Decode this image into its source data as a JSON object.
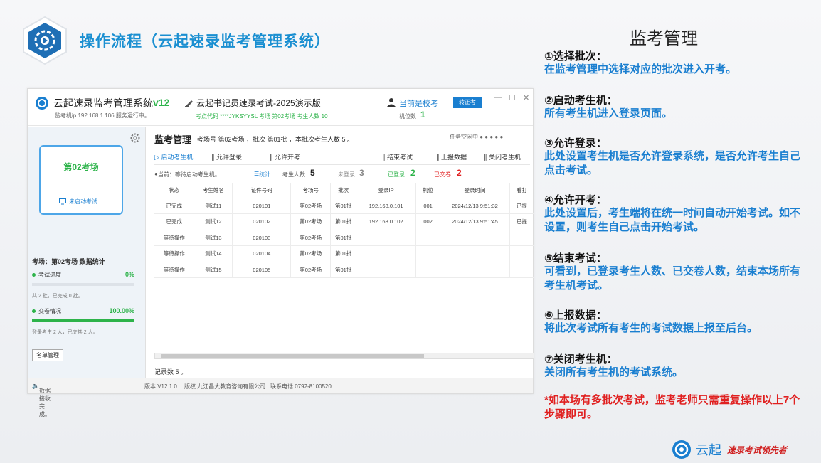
{
  "slide": {
    "title": "操作流程（云起速录监考管理系统）",
    "brand_name": "云起",
    "brand_slogan": "速录考试领先者"
  },
  "app": {
    "name": "云起速录监考管理系统",
    "version": "v12",
    "ip_line": "监考机ip 192.168.1.106 服务运行中。",
    "exam_name": "云起书记员速录考试-2025演示版",
    "exam_code_line": "考点代码 ****JYKSYYSL 考场 第02考场 考生人数 10",
    "invigilator_label": "当前是校考",
    "seat_label": "机位数",
    "seat_count": "1",
    "swap_button": "转正考",
    "window_controls": {
      "min": "—",
      "max": "☐",
      "close": "✕"
    }
  },
  "left_panel": {
    "room_name": "第02考场",
    "room_state": "未启动考试",
    "stats_title": "考场：第02考场 数据统计",
    "progress_label": "考试进度",
    "progress_value": "0%",
    "progress_fraction": 0,
    "progress_desc": "共 2 批，已完成 0 批。",
    "submit_label": "交卷情况",
    "submit_value": "100.00%",
    "submit_fraction": 1,
    "submit_desc": "登录考生 2 人，已交卷 2 人。",
    "roster_button": "名单管理"
  },
  "main": {
    "title": "监考管理",
    "info": "考场号 第02考场 ，批次 第01批 ，本批次考生人数 5 。",
    "task_label": "任务空闲中 ● ● ● ● ●",
    "toolbar": {
      "start": "启动考生机",
      "allow_login": "允许登录",
      "allow_start": "允许开考",
      "end_exam": "结束考试",
      "upload": "上报数据",
      "shutdown": "关闭考生机"
    },
    "status": {
      "current": "当前：等待启动考生机。",
      "stats_label": "统计",
      "total_label": "考生人数",
      "total": "5",
      "not_logged_label": "未登录",
      "not_logged": "3",
      "logged_label": "已登录",
      "logged": "2",
      "submitted_label": "已交卷",
      "submitted": "2"
    },
    "table": {
      "headers": [
        "状态",
        "考生姓名",
        "证件号码",
        "考场号",
        "批次",
        "登录IP",
        "机位",
        "登录时间",
        "看打"
      ],
      "rows": [
        [
          "已完成",
          "测试11",
          "020101",
          "第02考场",
          "第01批",
          "192.168.0.101",
          "001",
          "2024/12/13 9:51:32",
          "已提"
        ],
        [
          "已完成",
          "测试12",
          "020102",
          "第02考场",
          "第01批",
          "192.168.0.102",
          "002",
          "2024/12/13 9:51:45",
          "已提"
        ],
        [
          "等待操作",
          "测试13",
          "020103",
          "第02考场",
          "第01批",
          "",
          "",
          "",
          ""
        ],
        [
          "等待操作",
          "测试14",
          "020104",
          "第02考场",
          "第01批",
          "",
          "",
          "",
          ""
        ],
        [
          "等待操作",
          "测试15",
          "020105",
          "第02考场",
          "第01批",
          "",
          "",
          "",
          ""
        ]
      ]
    },
    "record_count": "记录数 5 。"
  },
  "status_bar": {
    "message": "数据接收完成。",
    "version": "版本 V12.1.0",
    "copyright": "版权 九江昌大教育咨询有限公司",
    "phone": "联系电话 0792-8100520"
  },
  "guide": {
    "title": "监考管理",
    "steps": [
      {
        "heading": "①选择批次：",
        "desc": "在监考管理中选择对应的批次进入开考。"
      },
      {
        "heading": "②启动考生机：",
        "desc": "所有考生机进入登录页面。"
      },
      {
        "heading": "③允许登录：",
        "desc": "此处设置考生机是否允许登录系统，是否允许考生自己点击考试。"
      },
      {
        "heading": "④允许开考：",
        "desc": "此处设置后，考生端将在统一时间自动开始考试。如不设置，则考生自己点击开始考试。"
      },
      {
        "heading": "⑤结束考试：",
        "desc": "可看到，已登录考生人数、已交卷人数，结束本场所有考生机考试。"
      },
      {
        "heading": "⑥上报数据：",
        "desc": "将此次考试所有考生的考试数据上报至后台。"
      },
      {
        "heading": "⑦关闭考生机：",
        "desc": "关闭所有考生机的考试系统。"
      }
    ],
    "note": "*如本场有多批次考试，监考老师只需重复操作以上7个步骤即可。"
  }
}
